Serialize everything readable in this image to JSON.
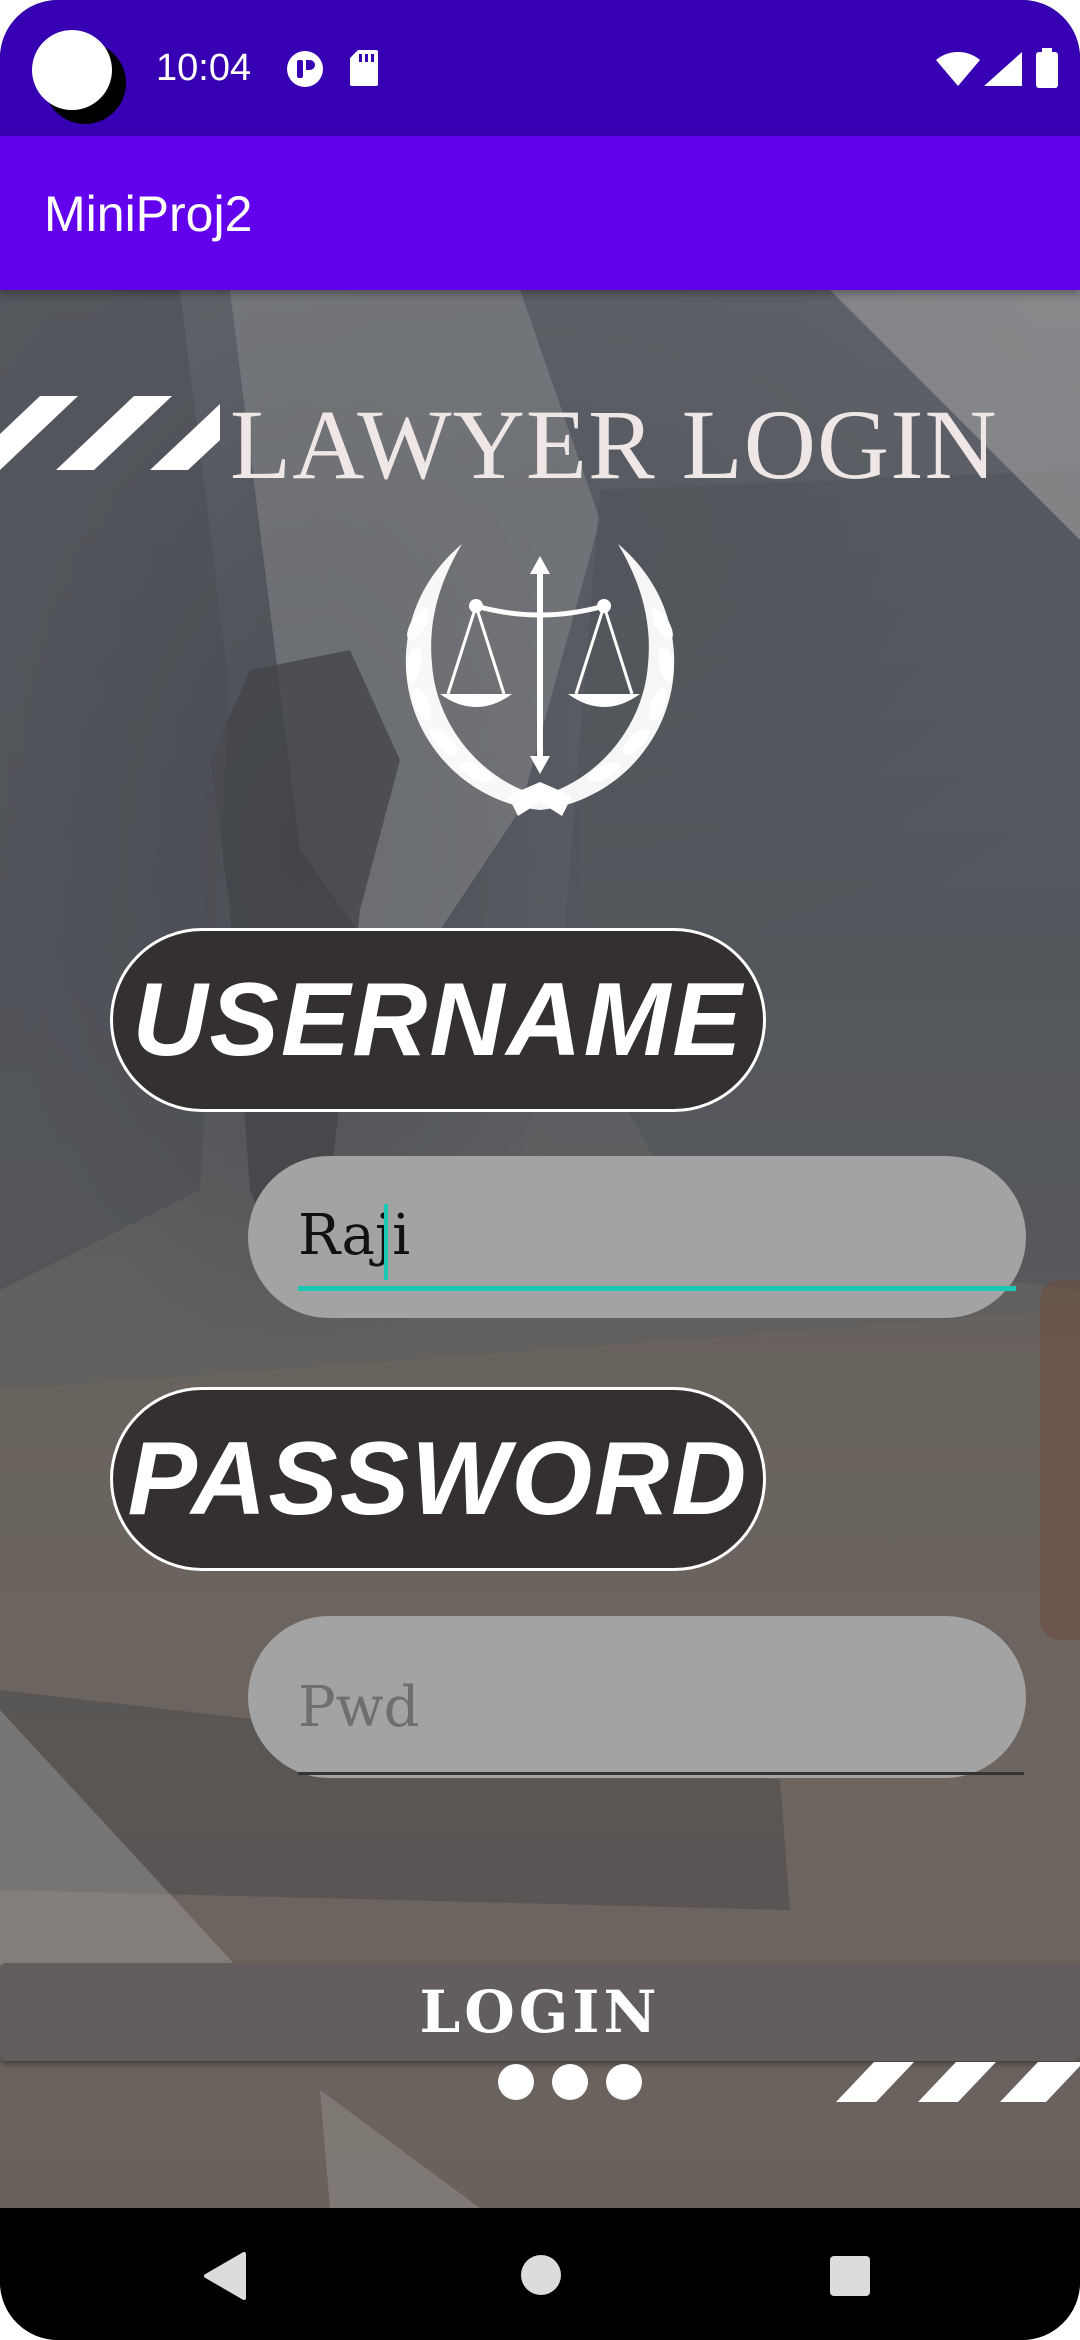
{
  "status_bar": {
    "time": "10:04",
    "icons": [
      "app-notification-icon",
      "sd-card-icon",
      "wifi-icon",
      "cell-signal-icon",
      "battery-icon"
    ]
  },
  "app_bar": {
    "title": "MiniProj2"
  },
  "login_screen": {
    "heading": "LAWYER LOGIN",
    "emblem": "scales-of-justice-icon",
    "username_label": "USERNAME",
    "username_value": "Raji",
    "password_label": "PASSWORD",
    "password_placeholder": "Pwd",
    "login_button": "LOGIN"
  },
  "nav_bar": {
    "buttons": [
      "back-icon",
      "home-icon",
      "recents-icon"
    ]
  },
  "colors": {
    "status_bar": "#3700b3",
    "app_bar": "#6200ee",
    "label_pill": "#353030",
    "input_pill": "#a3a3a3",
    "focus_accent": "#19c9b6",
    "login_button": "#625e5e"
  }
}
